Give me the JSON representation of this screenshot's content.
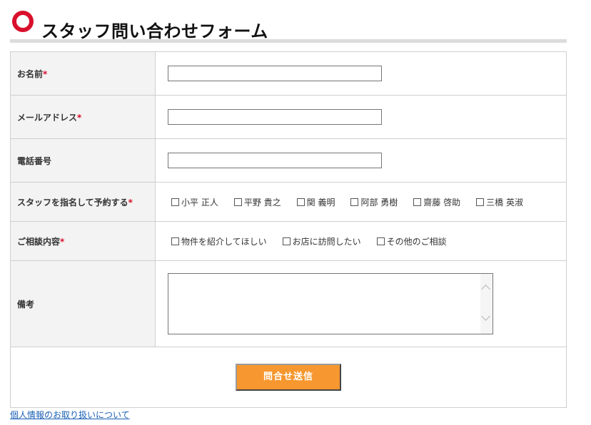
{
  "header": {
    "title": "スタッフ問い合わせフォーム"
  },
  "colors": {
    "accent": "#d8102d",
    "submit": "#f6972f",
    "link": "#1a5fb4"
  },
  "form": {
    "required_mark": "*",
    "name": {
      "label": "お名前",
      "value": ""
    },
    "email": {
      "label": "メールアドレス",
      "value": ""
    },
    "phone": {
      "label": "電話番号",
      "value": ""
    },
    "staff": {
      "label": "スタッフを指名して予約する",
      "options": [
        "小平 正人",
        "平野 貴之",
        "関 義明",
        "阿部 勇樹",
        "齋藤 啓助",
        "三橋 英淑"
      ]
    },
    "consult": {
      "label": "ご相談内容",
      "options": [
        "物件を紹介してほしい",
        "お店に訪問したい",
        "その他のご相談"
      ]
    },
    "notes": {
      "label": "備考",
      "value": ""
    },
    "submit_label": "問合せ送信"
  },
  "footer": {
    "privacy_link": "個人情報のお取り扱いについて"
  }
}
